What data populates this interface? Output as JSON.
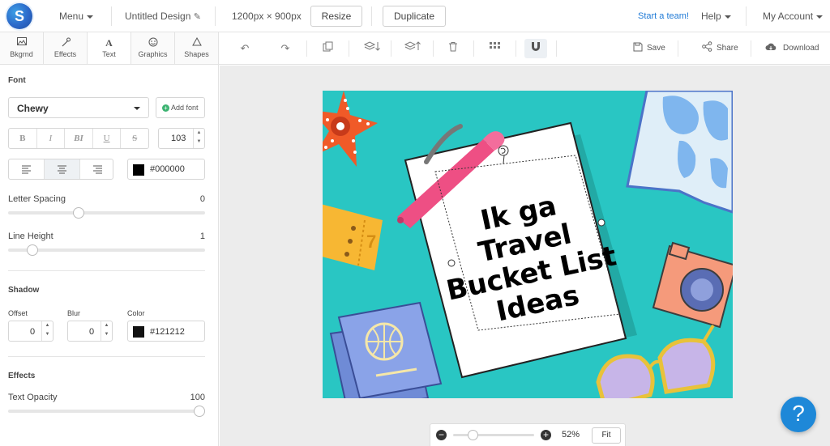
{
  "topbar": {
    "logo": "S",
    "menu": "Menu",
    "design_name": "Untitled Design",
    "dimensions": "1200px × 900px",
    "resize": "Resize",
    "duplicate": "Duplicate",
    "start_team": "Start a team!",
    "help": "Help",
    "account": "My Account"
  },
  "left_tabs": [
    {
      "label": "Bkgrnd",
      "icon": "image-icon"
    },
    {
      "label": "Effects",
      "icon": "wand-icon"
    },
    {
      "label": "Text",
      "icon": "text-icon"
    },
    {
      "label": "Graphics",
      "icon": "smiley-icon"
    },
    {
      "label": "Shapes",
      "icon": "triangle-icon"
    }
  ],
  "toolbar": {
    "save": "Save",
    "share": "Share",
    "download": "Download"
  },
  "font": {
    "section": "Font",
    "family": "Chewy",
    "add_font": "Add font",
    "styles": [
      "B",
      "I",
      "BI",
      "U",
      "S"
    ],
    "size": "103",
    "color_hex": "#000000",
    "letter_spacing_label": "Letter Spacing",
    "letter_spacing": "0",
    "letter_spacing_level": 0.35,
    "line_height_label": "Line Height",
    "line_height": "1",
    "line_height_level": 0.1
  },
  "shadow": {
    "section": "Shadow",
    "offset_label": "Offset",
    "offset": "0",
    "blur_label": "Blur",
    "blur": "0",
    "color_label": "Color",
    "color_hex": "#121212"
  },
  "effects": {
    "section": "Effects",
    "opacity_label": "Text Opacity",
    "opacity": "100",
    "opacity_level": 1.0
  },
  "canvas": {
    "background": "#29c6c3",
    "text_lines": [
      "Ik ga",
      "Travel",
      "Bucket List",
      "Ideas"
    ]
  },
  "zoom": {
    "value": "52%",
    "fit": "Fit"
  },
  "help_fab": "?"
}
